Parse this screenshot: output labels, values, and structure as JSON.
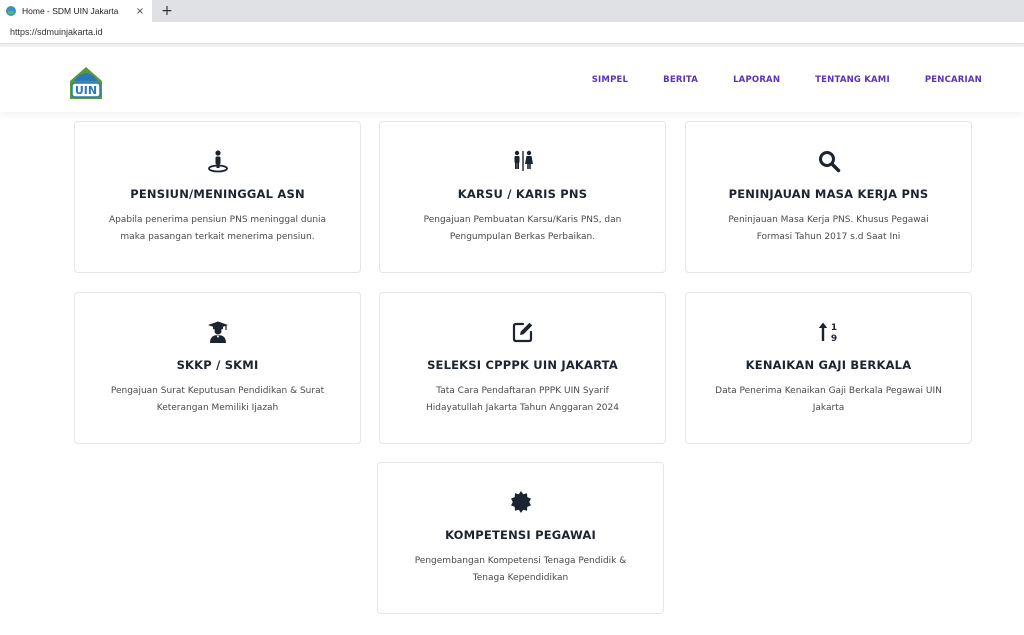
{
  "browser": {
    "tab_title": "Home - SDM UIN Jakarta",
    "tab_close": "×",
    "new_tab": "+",
    "url": "https://sdmuinjakarta.id"
  },
  "site": {
    "logo_text": "UIN",
    "nav": [
      "SIMPEL",
      "BERITA",
      "LAPORAN",
      "TENTANG KAMI",
      "PENCARIAN"
    ]
  },
  "cards": [
    {
      "icon": "person-pin-icon",
      "title": "PENSIUN/MENINGGAL ASN",
      "desc": "Apabila penerima pensiun PNS meninggal dunia maka pasangan terkait menerima pensiun."
    },
    {
      "icon": "restroom-icon",
      "title": "KARSU / KARIS PNS",
      "desc": "Pengajuan Pembuatan Karsu/Karis PNS, dan Pengumpulan Berkas Perbaikan."
    },
    {
      "icon": "search-icon",
      "title": "PENINJAUAN MASA KERJA PNS",
      "desc": "Peninjauan Masa Kerja PNS. Khusus Pegawai Formasi Tahun 2017 s.d Saat Ini"
    },
    {
      "icon": "graduate-icon",
      "title": "SKKP / SKMI",
      "desc": "Pengajuan Surat Keputusan Pendidikan & Surat Keterangan Memiliki Ijazah"
    },
    {
      "icon": "edit-icon",
      "title": "SELEKSI CPPPK UIN JAKARTA",
      "desc": "Tata Cara Pendaftaran PPPK UIN Syarif Hidayatullah Jakarta Tahun Anggaran 2024"
    },
    {
      "icon": "sort-numeric-icon",
      "title": "KENAIKAN GAJI BERKALA",
      "desc": "Data Penerima Kenaikan Gaji Berkala Pegawai UIN Jakarta"
    },
    {
      "icon": "certificate-icon",
      "title": "KOMPETENSI PEGAWAI",
      "desc": "Pengembangan Kompetensi Tenaga Pendidik & Tenaga Kependidikan"
    }
  ],
  "colors": {
    "nav": "#5a34b5",
    "title": "#1c2430",
    "icon": "#1c2430"
  }
}
